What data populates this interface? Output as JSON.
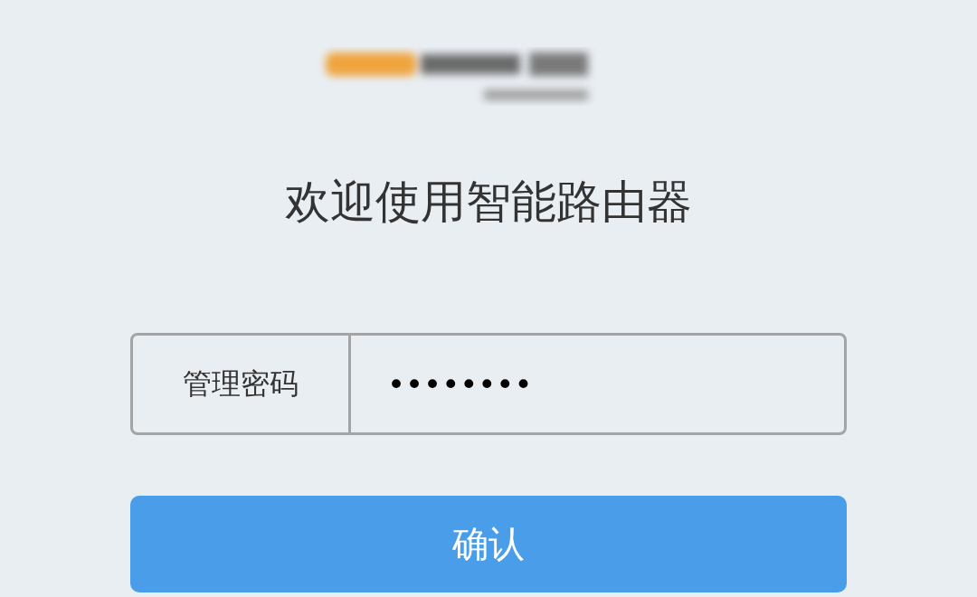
{
  "title": "欢迎使用智能路由器",
  "password_field": {
    "label": "管理密码",
    "value": "••••••••"
  },
  "confirm_button": {
    "label": "确认"
  }
}
